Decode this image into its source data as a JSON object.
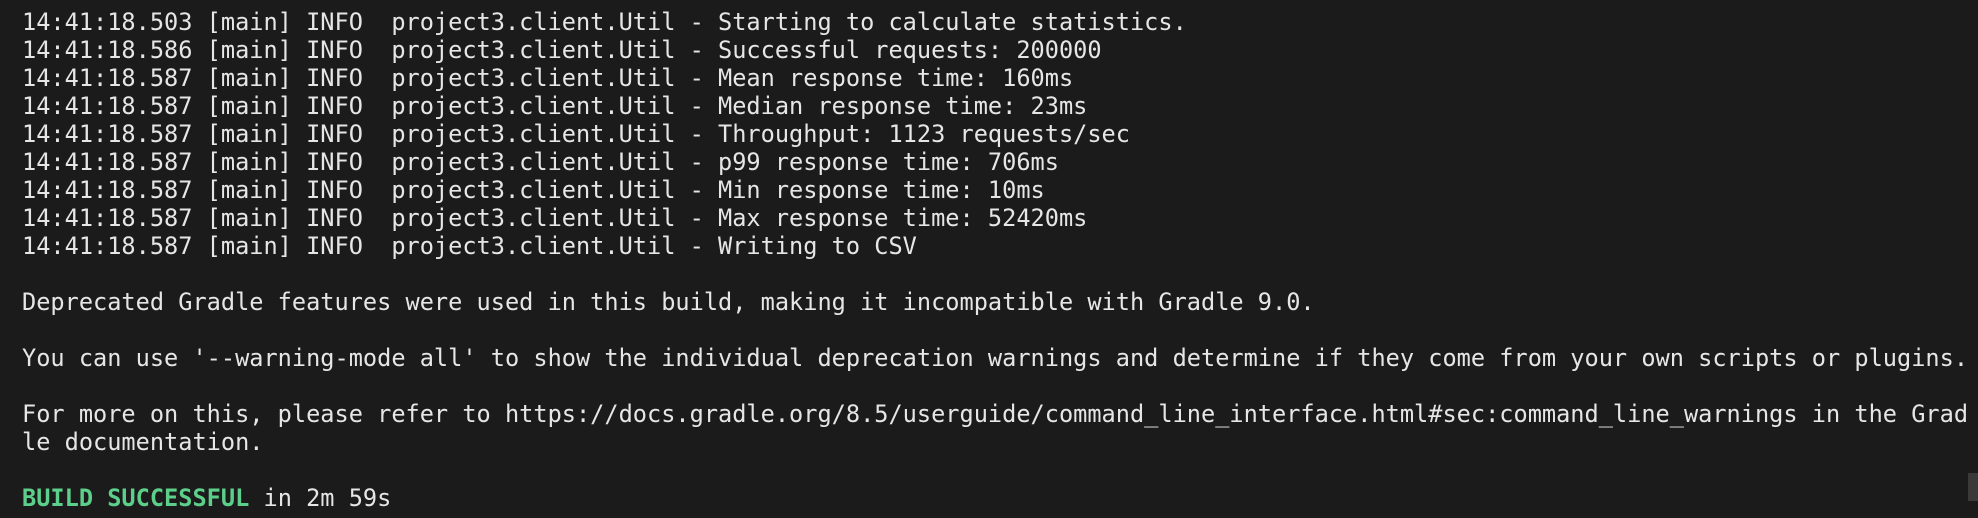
{
  "log_lines": [
    "14:41:18.503 [main] INFO  project3.client.Util - Starting to calculate statistics.",
    "14:41:18.586 [main] INFO  project3.client.Util - Successful requests: 200000",
    "14:41:18.587 [main] INFO  project3.client.Util - Mean response time: 160ms",
    "14:41:18.587 [main] INFO  project3.client.Util - Median response time: 23ms",
    "14:41:18.587 [main] INFO  project3.client.Util - Throughput: 1123 requests/sec",
    "14:41:18.587 [main] INFO  project3.client.Util - p99 response time: 706ms",
    "14:41:18.587 [main] INFO  project3.client.Util - Min response time: 10ms",
    "14:41:18.587 [main] INFO  project3.client.Util - Max response time: 52420ms",
    "14:41:18.587 [main] INFO  project3.client.Util - Writing to CSV"
  ],
  "messages": {
    "deprecated": "Deprecated Gradle features were used in this build, making it incompatible with Gradle 9.0.",
    "warning_mode": "You can use '--warning-mode all' to show the individual deprecation warnings and determine if they come from your own scripts or plugins.",
    "more_info_line1": "For more on this, please refer to https://docs.gradle.org/8.5/userguide/command_line_interface.html#sec:command_line_warnings in the Grad",
    "more_info_line2": "le documentation."
  },
  "build": {
    "status": "BUILD SUCCESSFUL",
    "duration_text": " in 2m 59s"
  },
  "colors": {
    "background": "#1b1b1b",
    "foreground": "#e6e6e6",
    "success": "#5ccf8a"
  }
}
